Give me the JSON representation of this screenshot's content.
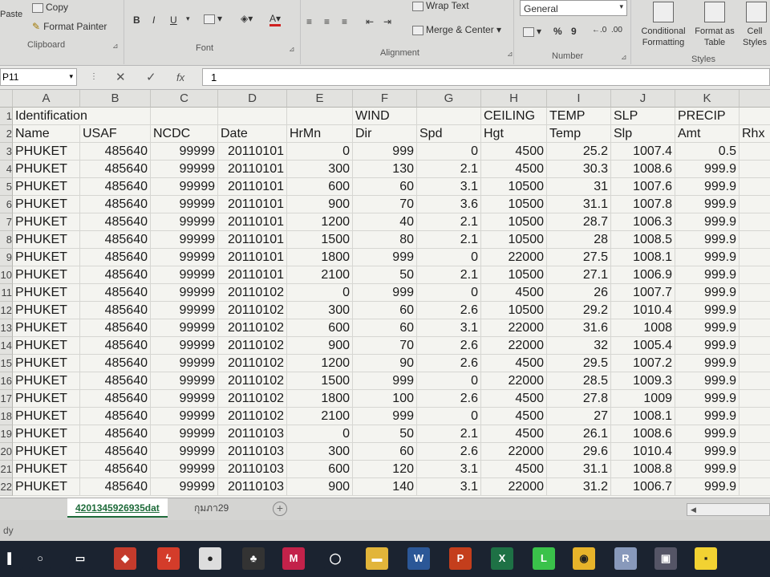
{
  "ribbon": {
    "paste": "Paste",
    "copy": "Copy",
    "format_painter": "Format Painter",
    "clipboard": "Clipboard",
    "font": "Font",
    "bold": "B",
    "italic": "I",
    "underline": "U",
    "font_color": "A",
    "wrap_text": "Wrap Text",
    "merge_center": "Merge & Center",
    "alignment": "Alignment",
    "number_format": "General",
    "percent": "%",
    "comma": "9",
    "number": "Number",
    "conditional_formatting": "Conditional Formatting",
    "format_as_table": "Format as Table",
    "cell_styles": "Cell Styles",
    "styles": "Styles"
  },
  "formula_bar": {
    "name_box": "P11",
    "fx": "fx",
    "value": "1"
  },
  "columns": [
    "A",
    "B",
    "C",
    "D",
    "E",
    "F",
    "G",
    "H",
    "I",
    "J",
    "K"
  ],
  "rows": [
    "1",
    "2",
    "3",
    "4",
    "5",
    "6",
    "7",
    "8",
    "9",
    "10",
    "11",
    "12",
    "13",
    "14",
    "15",
    "16",
    "17",
    "18",
    "19",
    "20",
    "21",
    "22"
  ],
  "header_row1": {
    "A": "Identification",
    "F": "WIND",
    "H": "CEILING",
    "I": "TEMP",
    "J": "SLP",
    "K": "PRECIP"
  },
  "header_row2": {
    "A": "Name",
    "B": "USAF",
    "C": "NCDC",
    "D": "Date",
    "E": "HrMn",
    "F": "Dir",
    "G": "Spd",
    "H": "Hgt",
    "I": "Temp",
    "J": "Slp",
    "K": "Amt",
    "L": "Rhx"
  },
  "data_rows": [
    [
      "PHUKET",
      "485640",
      "99999",
      "20110101",
      "0",
      "999",
      "0",
      "4500",
      "25.2",
      "1007.4",
      "0.5"
    ],
    [
      "PHUKET",
      "485640",
      "99999",
      "20110101",
      "300",
      "130",
      "2.1",
      "4500",
      "30.3",
      "1008.6",
      "999.9"
    ],
    [
      "PHUKET",
      "485640",
      "99999",
      "20110101",
      "600",
      "60",
      "3.1",
      "10500",
      "31",
      "1007.6",
      "999.9"
    ],
    [
      "PHUKET",
      "485640",
      "99999",
      "20110101",
      "900",
      "70",
      "3.6",
      "10500",
      "31.1",
      "1007.8",
      "999.9"
    ],
    [
      "PHUKET",
      "485640",
      "99999",
      "20110101",
      "1200",
      "40",
      "2.1",
      "10500",
      "28.7",
      "1006.3",
      "999.9"
    ],
    [
      "PHUKET",
      "485640",
      "99999",
      "20110101",
      "1500",
      "80",
      "2.1",
      "10500",
      "28",
      "1008.5",
      "999.9"
    ],
    [
      "PHUKET",
      "485640",
      "99999",
      "20110101",
      "1800",
      "999",
      "0",
      "22000",
      "27.5",
      "1008.1",
      "999.9"
    ],
    [
      "PHUKET",
      "485640",
      "99999",
      "20110101",
      "2100",
      "50",
      "2.1",
      "10500",
      "27.1",
      "1006.9",
      "999.9"
    ],
    [
      "PHUKET",
      "485640",
      "99999",
      "20110102",
      "0",
      "999",
      "0",
      "4500",
      "26",
      "1007.7",
      "999.9"
    ],
    [
      "PHUKET",
      "485640",
      "99999",
      "20110102",
      "300",
      "60",
      "2.6",
      "10500",
      "29.2",
      "1010.4",
      "999.9"
    ],
    [
      "PHUKET",
      "485640",
      "99999",
      "20110102",
      "600",
      "60",
      "3.1",
      "22000",
      "31.6",
      "1008",
      "999.9"
    ],
    [
      "PHUKET",
      "485640",
      "99999",
      "20110102",
      "900",
      "70",
      "2.6",
      "22000",
      "32",
      "1005.4",
      "999.9"
    ],
    [
      "PHUKET",
      "485640",
      "99999",
      "20110102",
      "1200",
      "90",
      "2.6",
      "4500",
      "29.5",
      "1007.2",
      "999.9"
    ],
    [
      "PHUKET",
      "485640",
      "99999",
      "20110102",
      "1500",
      "999",
      "0",
      "22000",
      "28.5",
      "1009.3",
      "999.9"
    ],
    [
      "PHUKET",
      "485640",
      "99999",
      "20110102",
      "1800",
      "100",
      "2.6",
      "4500",
      "27.8",
      "1009",
      "999.9"
    ],
    [
      "PHUKET",
      "485640",
      "99999",
      "20110102",
      "2100",
      "999",
      "0",
      "4500",
      "27",
      "1008.1",
      "999.9"
    ],
    [
      "PHUKET",
      "485640",
      "99999",
      "20110103",
      "0",
      "50",
      "2.1",
      "4500",
      "26.1",
      "1008.6",
      "999.9"
    ],
    [
      "PHUKET",
      "485640",
      "99999",
      "20110103",
      "300",
      "60",
      "2.6",
      "22000",
      "29.6",
      "1010.4",
      "999.9"
    ],
    [
      "PHUKET",
      "485640",
      "99999",
      "20110103",
      "600",
      "120",
      "3.1",
      "4500",
      "31.1",
      "1008.8",
      "999.9"
    ],
    [
      "PHUKET",
      "485640",
      "99999",
      "20110103",
      "900",
      "140",
      "3.1",
      "22000",
      "31.2",
      "1006.7",
      "999.9"
    ]
  ],
  "sheets": {
    "active": "4201345926935dat",
    "other": "กุมภา29",
    "add": "+"
  },
  "status": "dy",
  "taskbar_icons": [
    "start-icon",
    "search-icon",
    "task-view-icon",
    "app-red-icon",
    "app-flash-icon",
    "app-record-icon",
    "app-game-icon",
    "app-mega-icon",
    "app-circle-icon",
    "file-explorer-icon",
    "word-icon",
    "powerpoint-icon",
    "excel-icon",
    "line-icon",
    "chrome-icon",
    "app-r-icon",
    "app-photo-icon",
    "sticky-notes-icon"
  ]
}
